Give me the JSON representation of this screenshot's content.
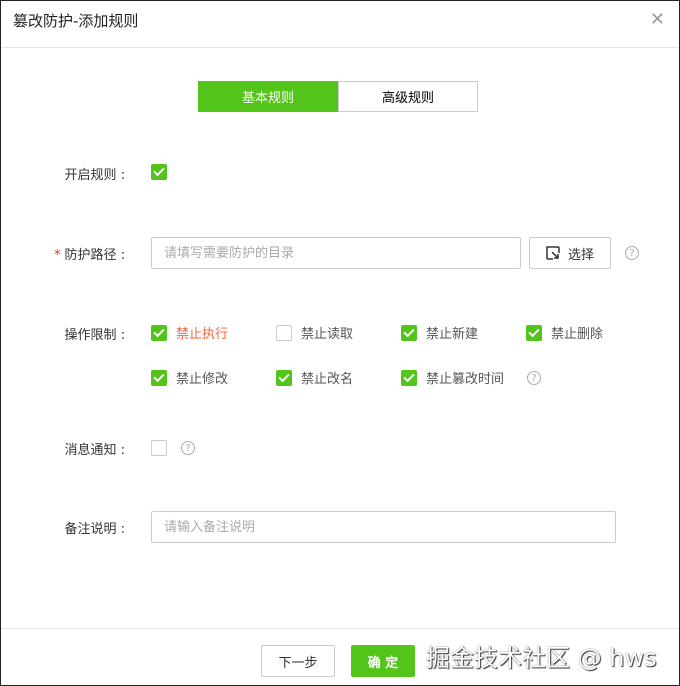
{
  "dialog": {
    "title": "篡改防护-添加规则",
    "close": "✕"
  },
  "tabs": [
    {
      "label": "基本规则",
      "active": true
    },
    {
      "label": "高级规则",
      "active": false
    }
  ],
  "form": {
    "enable": {
      "label": "开启规则 :",
      "checked": true
    },
    "path": {
      "label": "防护路径 :",
      "required_mark": "*",
      "placeholder": "请填写需要防护的目录",
      "value": "",
      "select_label": "选择"
    },
    "restrict": {
      "label": "操作限制 :",
      "options": [
        {
          "label": "禁止执行",
          "checked": true
        },
        {
          "label": "禁止读取",
          "checked": false
        },
        {
          "label": "禁止新建",
          "checked": true
        },
        {
          "label": "禁止删除",
          "checked": true
        },
        {
          "label": "禁止修改",
          "checked": true
        },
        {
          "label": "禁止改名",
          "checked": true
        },
        {
          "label": "禁止篡改时间",
          "checked": true
        }
      ]
    },
    "notify": {
      "label": "消息通知 :",
      "checked": false
    },
    "remark": {
      "label": "备注说明 :",
      "placeholder": "请输入备注说明",
      "value": ""
    }
  },
  "footer": {
    "next": "下一步",
    "confirm": "确 定"
  },
  "help": "?",
  "watermark": "掘金技术社区 @ hws",
  "colors": {
    "accent": "#52c41a",
    "highlight": "#f0643c"
  }
}
